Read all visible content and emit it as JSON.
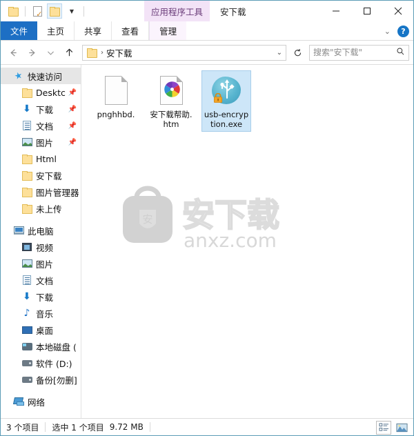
{
  "window": {
    "title": "安下载",
    "contextual_tab": "应用程序工具",
    "minimize_label": "最小化",
    "maximize_label": "最大化",
    "close_label": "关闭"
  },
  "quick_access_toolbar": {
    "items": [
      {
        "name": "folder-icon",
        "label": "属性"
      },
      {
        "name": "properties-icon",
        "label": "属性"
      },
      {
        "name": "new-folder-icon",
        "label": "新建文件夹"
      },
      {
        "name": "customize-dropdown",
        "label": "自定义快速访问工具栏"
      }
    ]
  },
  "ribbon": {
    "tabs": [
      {
        "label": "文件",
        "active": true
      },
      {
        "label": "主页",
        "active": false
      },
      {
        "label": "共享",
        "active": false
      },
      {
        "label": "查看",
        "active": false
      },
      {
        "label": "管理",
        "active": false,
        "contextual": true
      }
    ],
    "collapse_label": "展开功能区",
    "help_label": "?"
  },
  "address_bar": {
    "back_label": "后退",
    "forward_label": "前进",
    "recent_label": "最近浏览的位置",
    "up_label": "上移一级",
    "breadcrumb": "安下载",
    "breadcrumb_separator": "›",
    "dropdown_label": "浏览历史",
    "refresh_label": "刷新"
  },
  "search": {
    "placeholder": "搜索\"安下载\"",
    "value": ""
  },
  "sidebar": {
    "groups": [
      {
        "header": {
          "label": "快速访问",
          "icon": "star-pin-icon",
          "selected": true
        },
        "items": [
          {
            "label": "Desktc",
            "icon": "folder-icon",
            "pinned": true
          },
          {
            "label": "下载",
            "icon": "download-icon",
            "pinned": true
          },
          {
            "label": "文档",
            "icon": "documents-icon",
            "pinned": true
          },
          {
            "label": "图片",
            "icon": "pictures-icon",
            "pinned": true
          },
          {
            "label": "Html",
            "icon": "folder-icon",
            "pinned": false
          },
          {
            "label": "安下载",
            "icon": "folder-icon",
            "pinned": false
          },
          {
            "label": "图片管理器",
            "icon": "folder-icon",
            "pinned": false
          },
          {
            "label": "未上传",
            "icon": "folder-icon",
            "pinned": false
          }
        ]
      },
      {
        "header": {
          "label": "此电脑",
          "icon": "this-pc-icon",
          "selected": false
        },
        "items": [
          {
            "label": "视频",
            "icon": "videos-icon",
            "pinned": false
          },
          {
            "label": "图片",
            "icon": "pictures-icon",
            "pinned": false
          },
          {
            "label": "文档",
            "icon": "documents-icon",
            "pinned": false
          },
          {
            "label": "下载",
            "icon": "download-icon",
            "pinned": false
          },
          {
            "label": "音乐",
            "icon": "music-icon",
            "pinned": false
          },
          {
            "label": "桌面",
            "icon": "desktop-icon",
            "pinned": false
          },
          {
            "label": "本地磁盘 (",
            "icon": "local-disk-icon",
            "pinned": false
          },
          {
            "label": "软件 (D:)",
            "icon": "drive-icon",
            "pinned": false
          },
          {
            "label": "备份[勿删]",
            "icon": "drive-icon",
            "pinned": false
          }
        ]
      },
      {
        "header": {
          "label": "网络",
          "icon": "network-icon",
          "selected": false
        },
        "items": []
      }
    ]
  },
  "files": [
    {
      "name": "pnghhbd.",
      "icon": "blank-document-icon",
      "selected": false
    },
    {
      "name": "安下载帮助.htm",
      "icon": "html-document-icon",
      "selected": false
    },
    {
      "name": "usb-encryption.exe",
      "icon": "usb-encryption-icon",
      "selected": true
    }
  ],
  "watermark": {
    "logo_char": "安",
    "brand": "安下载",
    "site": "anxz.com"
  },
  "status_bar": {
    "item_count": "3 个项目",
    "selection": "选中 1 个项目",
    "selection_size": "9.72 MB",
    "views": [
      {
        "name": "details-view",
        "active": true
      },
      {
        "name": "large-icons-view",
        "active": false
      }
    ]
  },
  "colors": {
    "file_tab": "#1d6fc4",
    "contextual_tab": "#f3e3f7",
    "selection": "#cde6f8",
    "window_border": "#5b9bb5",
    "folder": "#fde09a"
  }
}
